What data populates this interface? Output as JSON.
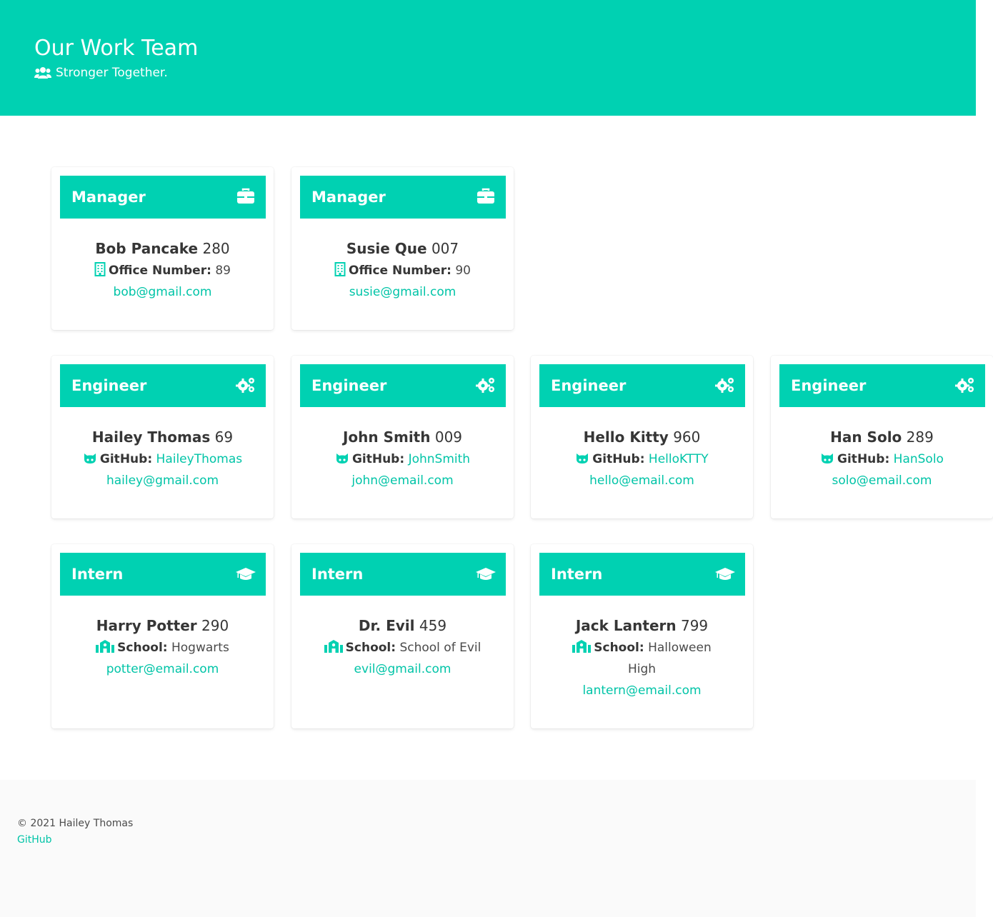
{
  "hero": {
    "title": "Our Work Team",
    "subtitle": "Stronger Together.",
    "subtitle_icon": "users-icon"
  },
  "colors": {
    "accent": "#00d1b2",
    "link": "#00c4a7",
    "text": "#4a4a4a",
    "footer_bg": "#fafafa"
  },
  "managers": [
    {
      "role": "Manager",
      "icon": "briefcase-icon",
      "name": "Bob Pancake",
      "id": "280",
      "detail_label": "Office Number:",
      "detail_value": "89",
      "detail_icon": "building-icon",
      "email": "bob@gmail.com"
    },
    {
      "role": "Manager",
      "icon": "briefcase-icon",
      "name": "Susie Que",
      "id": "007",
      "detail_label": "Office Number:",
      "detail_value": "90",
      "detail_icon": "building-icon",
      "email": "susie@gmail.com"
    }
  ],
  "engineers": [
    {
      "role": "Engineer",
      "icon": "cogs-icon",
      "name": "Hailey Thomas",
      "id": "69",
      "detail_label": "GitHub:",
      "detail_value": "HaileyThomas",
      "detail_icon": "github-icon",
      "email": "hailey@gmail.com"
    },
    {
      "role": "Engineer",
      "icon": "cogs-icon",
      "name": "John Smith",
      "id": "009",
      "detail_label": "GitHub:",
      "detail_value": "JohnSmith",
      "detail_icon": "github-icon",
      "email": "john@email.com"
    },
    {
      "role": "Engineer",
      "icon": "cogs-icon",
      "name": "Hello Kitty",
      "id": "960",
      "detail_label": "GitHub:",
      "detail_value": "HelloKTTY",
      "detail_icon": "github-icon",
      "email": "hello@email.com"
    },
    {
      "role": "Engineer",
      "icon": "cogs-icon",
      "name": "Han Solo",
      "id": "289",
      "detail_label": "GitHub:",
      "detail_value": "HanSolo",
      "detail_icon": "github-icon",
      "email": "solo@email.com"
    }
  ],
  "interns": [
    {
      "role": "Intern",
      "icon": "graduation-cap-icon",
      "name": "Harry Potter",
      "id": "290",
      "detail_label": "School:",
      "detail_value": "Hogwarts",
      "detail_icon": "school-icon",
      "email": "potter@email.com"
    },
    {
      "role": "Intern",
      "icon": "graduation-cap-icon",
      "name": "Dr. Evil",
      "id": "459",
      "detail_label": "School:",
      "detail_value": "School of Evil",
      "detail_icon": "school-icon",
      "email": "evil@gmail.com"
    },
    {
      "role": "Intern",
      "icon": "graduation-cap-icon",
      "name": "Jack Lantern",
      "id": "799",
      "detail_label": "School:",
      "detail_value": "Halloween High",
      "detail_icon": "school-icon",
      "email": "lantern@email.com"
    }
  ],
  "footer": {
    "copyright": "© 2021 Hailey Thomas",
    "link_label": "GitHub"
  }
}
